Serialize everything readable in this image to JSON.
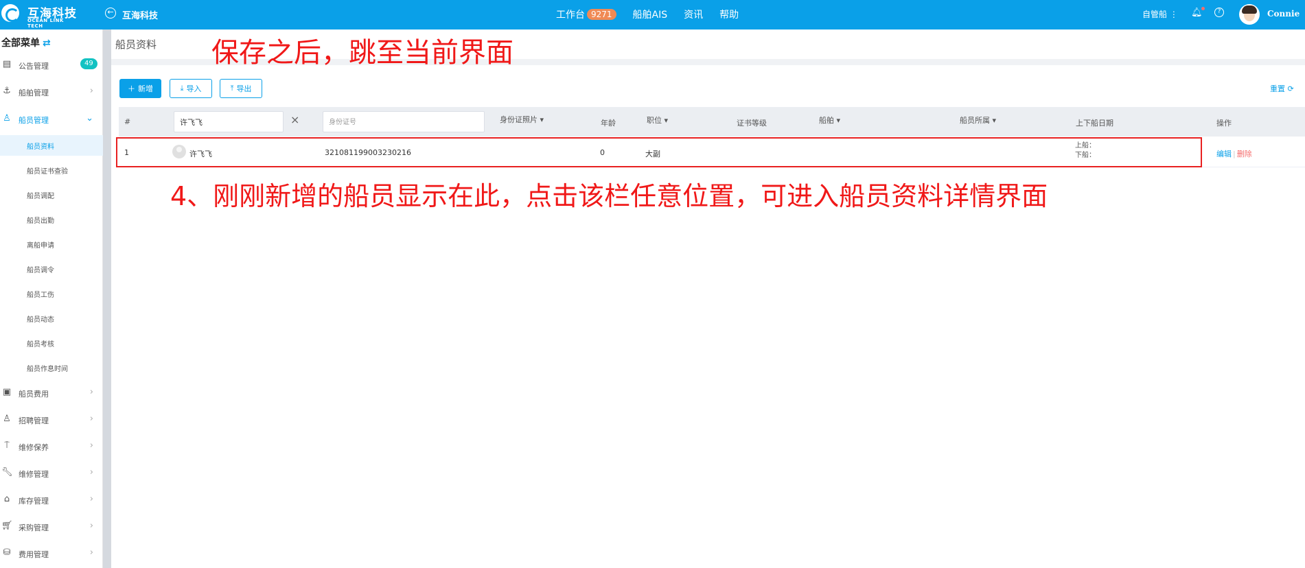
{
  "topbar": {
    "logo_cn": "互海科技",
    "logo_en": "OCEAN LINK TECH",
    "company": "互海科技",
    "nav": [
      {
        "label": "工作台",
        "badge": "9271"
      },
      {
        "label": "船舶AIS"
      },
      {
        "label": "资讯"
      },
      {
        "label": "帮助"
      }
    ],
    "ship_select": "自管船 ⋮",
    "username": "Connie"
  },
  "sidebar": {
    "title": "全部菜单",
    "items": [
      {
        "icon": "notice-icon",
        "label": "公告管理",
        "badge": "49"
      },
      {
        "icon": "anchor-icon",
        "label": "船舶管理"
      },
      {
        "icon": "crew-icon",
        "label": "船员管理"
      }
    ],
    "sub_items": [
      {
        "label": "船员资料"
      },
      {
        "label": "船员证书查验"
      },
      {
        "label": "船员调配"
      },
      {
        "label": "船员出勤"
      },
      {
        "label": "离船申请"
      },
      {
        "label": "船员调令"
      },
      {
        "label": "船员工伤"
      },
      {
        "label": "船员动态"
      },
      {
        "label": "船员考核"
      },
      {
        "label": "船员作息时间"
      }
    ],
    "bottom_items": [
      {
        "icon": "wallet-icon",
        "label": "船员费用"
      },
      {
        "icon": "recruit-icon",
        "label": "招聘管理"
      },
      {
        "icon": "maintain-icon",
        "label": "维修保养"
      },
      {
        "icon": "wrench-icon",
        "label": "维修管理"
      },
      {
        "icon": "warehouse-icon",
        "label": "库存管理"
      },
      {
        "icon": "cart-icon",
        "label": "采购管理"
      },
      {
        "icon": "database-icon",
        "label": "费用管理"
      }
    ]
  },
  "page": {
    "title": "船员资料",
    "buttons": {
      "add": "新增",
      "import": "导入",
      "export": "导出"
    },
    "reset": "重置"
  },
  "table": {
    "headers": {
      "index": "#",
      "id_photo": "身份证照片",
      "age": "年龄",
      "position": "职位",
      "cert_level": "证书等级",
      "ship": "船舶",
      "ship_owner": "船员所属",
      "board_date": "上下船日期",
      "ops": "操作"
    },
    "filters": {
      "name_value": "许飞飞",
      "id_placeholder": "身份证号"
    },
    "rows": [
      {
        "index": "1",
        "name": "许飞飞",
        "id_number": "321081199003230216",
        "age": "0",
        "position": "大副",
        "board_on": "上船：",
        "board_off": "下船：",
        "edit": "编辑",
        "delete": "删除"
      }
    ]
  },
  "annotations": {
    "top": "保存之后，跳至当前界面",
    "middle": "4、刚刚新增的船员显示在此，点击该栏任意位置，可进入船员资料详情界面"
  },
  "colors": {
    "brand": "#0aa0e8",
    "annotation": "#f01818",
    "badge_orange": "#f08a55",
    "badge_teal": "#13c2c2"
  }
}
